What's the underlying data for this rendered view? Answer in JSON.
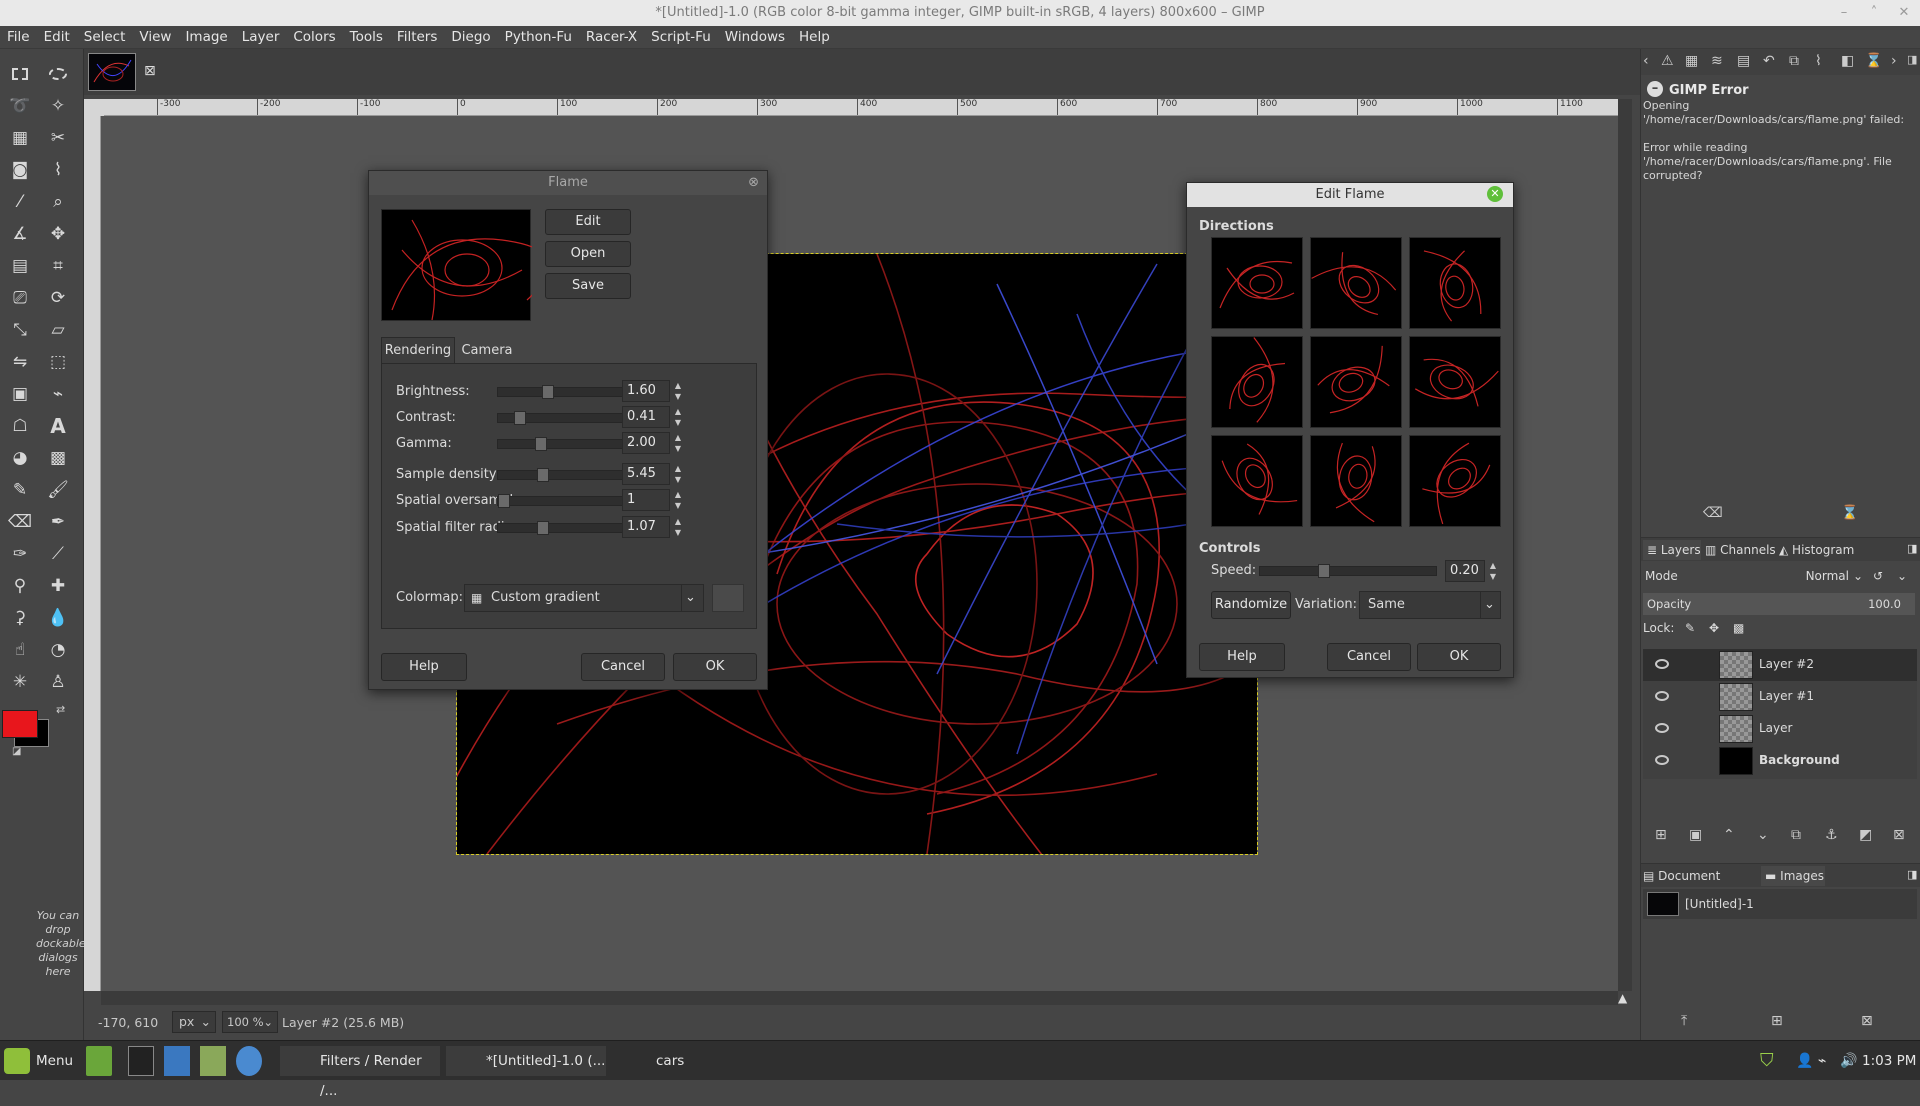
{
  "window": {
    "title": "*[Untitled]-1.0 (RGB color 8-bit gamma integer, GIMP built-in sRGB, 4 layers) 800x600 – GIMP"
  },
  "menu": [
    "File",
    "Edit",
    "Select",
    "View",
    "Image",
    "Layer",
    "Colors",
    "Tools",
    "Filters",
    "Diego",
    "Python-Fu",
    "Racer-X",
    "Script-Fu",
    "Windows",
    "Help"
  ],
  "rulers": {
    "top_ticks": [
      "-300",
      "-200",
      "-100",
      "0",
      "100",
      "200",
      "300",
      "400",
      "500",
      "600",
      "700",
      "800",
      "900",
      "1000",
      "1100"
    ]
  },
  "toolbox": {
    "drop_hint": "You can drop dockable dialogs here",
    "fg_color": "#e8161c",
    "bg_color": "#000000"
  },
  "flame": {
    "title": "Flame",
    "buttons": {
      "edit": "Edit",
      "open": "Open",
      "save": "Save",
      "help": "Help",
      "cancel": "Cancel",
      "ok": "OK"
    },
    "tabs": [
      "Rendering",
      "Camera"
    ],
    "params": [
      {
        "label": "Brightness:",
        "value": "1.60",
        "level": 0.32
      },
      {
        "label": "Contrast:",
        "value": "0.41",
        "level": 0.12
      },
      {
        "label": "Gamma:",
        "value": "2.00",
        "level": 0.27
      },
      {
        "label": "Sample density:",
        "value": "5.45",
        "level": 0.29
      },
      {
        "label": "Spatial oversample:",
        "value": "1",
        "level": 0.0
      },
      {
        "label": "Spatial filter radius:",
        "value": "1.07",
        "level": 0.29
      }
    ],
    "colormap_label": "Colormap:",
    "colormap_value": "Custom gradient"
  },
  "edit_flame": {
    "title": "Edit Flame",
    "directions_label": "Directions",
    "controls_label": "Controls",
    "speed_label": "Speed:",
    "speed_value": "0.20",
    "speed_level": 0.35,
    "randomize": "Randomize",
    "variation_label": "Variation:",
    "variation_value": "Same",
    "buttons": {
      "help": "Help",
      "cancel": "Cancel",
      "ok": "OK"
    }
  },
  "error": {
    "title": "GIMP Error",
    "message1": "Opening '/home/racer/Downloads/cars/flame.png' failed:",
    "message2": "Error while reading '/home/racer/Downloads/cars/flame.png'. File corrupted?"
  },
  "layers_panel": {
    "tabs": [
      "Layers",
      "Channels",
      "Histogram"
    ],
    "mode_label": "Mode",
    "mode_value": "Normal",
    "opacity_label": "Opacity",
    "opacity_value": "100.0",
    "lock_label": "Lock:",
    "layers": [
      {
        "name": "Layer #2"
      },
      {
        "name": "Layer #1"
      },
      {
        "name": "Layer"
      },
      {
        "name": "Background"
      }
    ]
  },
  "images_panel": {
    "tabs": [
      "Document History",
      "Images"
    ],
    "item": "[Untitled]-1"
  },
  "status": {
    "coords": "-170, 610",
    "unit": "px",
    "zoom": "100 %",
    "info": "Layer #2 (25.6 MB)"
  },
  "taskbar": {
    "menu": "Menu",
    "items": [
      "Filters / Render /...",
      "*[Untitled]-1.0 (...",
      "cars"
    ],
    "clock": "1:03 PM"
  }
}
